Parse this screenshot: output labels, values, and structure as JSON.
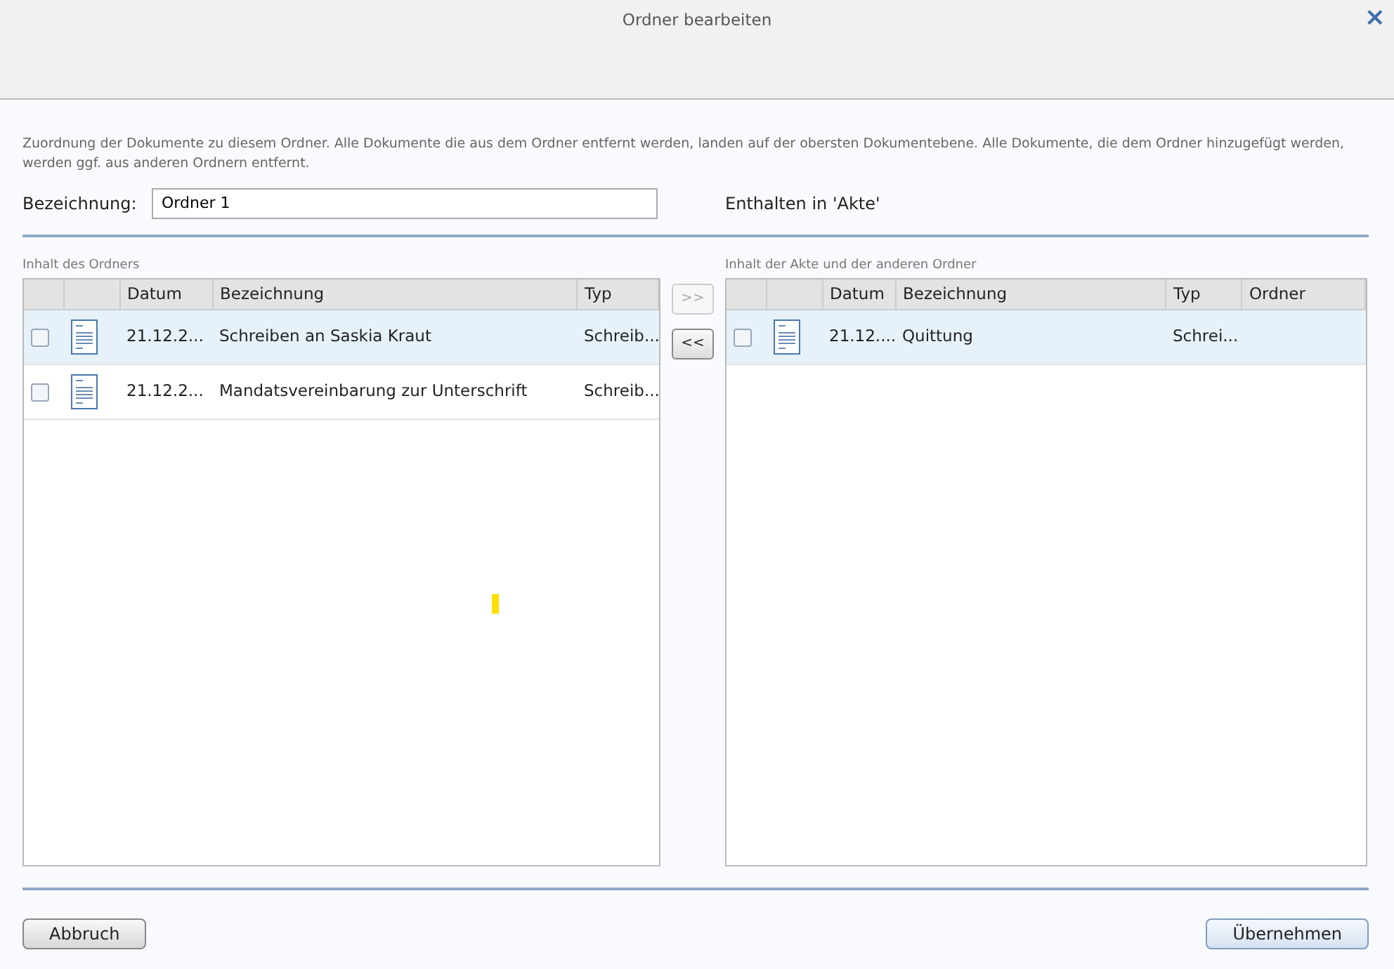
{
  "window": {
    "title": "Ordner bearbeiten",
    "close": "×"
  },
  "description": "Zuordnung der Dokumente zu diesem Ordner. Alle Dokumente die aus dem Ordner entfernt werden, landen auf der obersten Dokumentebene. Alle Dokumente, die dem Ordner hinzugefügt werden, werden ggf. aus anderen Ordnern entfernt.",
  "name_field": {
    "label": "Bezeichnung:",
    "value": "Ordner 1"
  },
  "contained_in": "Enthalten in 'Akte'",
  "left_table": {
    "title": "Inhalt des Ordners",
    "columns": [
      "Datum",
      "Bezeichnung",
      "Typ"
    ],
    "rows": [
      {
        "selected": true,
        "checked": false,
        "cells": [
          "21.12.2...",
          "Schreiben an Saskia Kraut",
          "Schreib..."
        ]
      },
      {
        "selected": false,
        "checked": false,
        "cells": [
          "21.12.2...",
          "Mandatsvereinbarung zur Unterschrift",
          "Schreib..."
        ]
      }
    ]
  },
  "move_buttons": [
    {
      "label": ">>",
      "disabled": true
    },
    {
      "label": "<<",
      "disabled": false
    }
  ],
  "right_table": {
    "title": "Inhalt der Akte und der anderen Ordner",
    "columns": [
      "Datum",
      "Bezeichnung",
      "Typ",
      "Ordner"
    ],
    "rows": [
      {
        "selected": true,
        "checked": false,
        "cells": [
          "21.12....",
          "Quittung",
          "Schrei...",
          ""
        ]
      }
    ]
  },
  "buttons": [
    {
      "label": "Abbruch",
      "kind": "cancel"
    },
    {
      "label": "Übernehmen",
      "kind": "primary"
    }
  ]
}
